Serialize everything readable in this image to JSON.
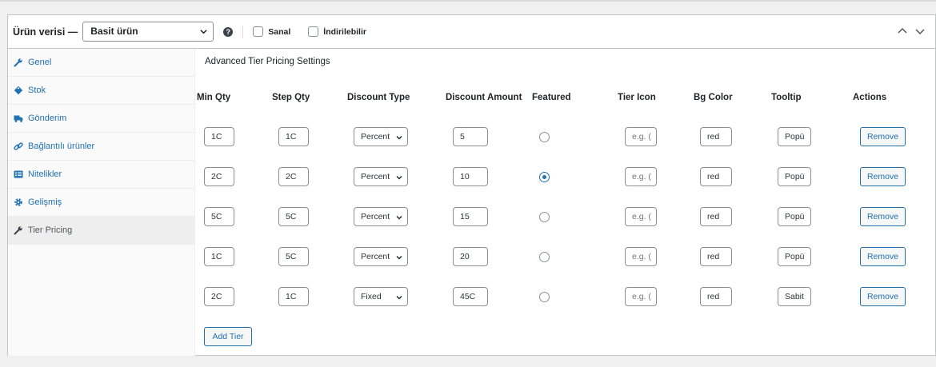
{
  "header": {
    "title": "Ürün verisi —",
    "product_type": "Basit ürün",
    "help_glyph": "?",
    "virtual_label": "Sanal",
    "downloadable_label": "İndirilebilir"
  },
  "sidebar": {
    "items": [
      {
        "label": "Genel",
        "icon": "wrench-icon",
        "active": false
      },
      {
        "label": "Stok",
        "icon": "tag-icon",
        "active": false
      },
      {
        "label": "Gönderim",
        "icon": "truck-icon",
        "active": false
      },
      {
        "label": "Bağlantılı ürünler",
        "icon": "link-icon",
        "active": false
      },
      {
        "label": "Nitelikler",
        "icon": "list-icon",
        "active": false
      },
      {
        "label": "Gelişmiş",
        "icon": "gear-icon",
        "active": false
      },
      {
        "label": "Tier Pricing",
        "icon": "wrench-icon",
        "active": true
      }
    ]
  },
  "content": {
    "title": "Advanced Tier Pricing Settings",
    "columns": [
      "Min Qty",
      "Step Qty",
      "Discount Type",
      "Discount Amount",
      "Featured",
      "Tier Icon",
      "Bg Color",
      "Tooltip",
      "Actions"
    ],
    "rows": [
      {
        "min_qty": "1C",
        "step_qty": "1C",
        "discount_type": "Percent",
        "amount": "5",
        "featured": false,
        "icon_placeholder": "e.g. (",
        "bg_color": "red",
        "tooltip": "Popü",
        "action": "Remove"
      },
      {
        "min_qty": "2C",
        "step_qty": "2C",
        "discount_type": "Percent",
        "amount": "10",
        "featured": true,
        "icon_placeholder": "e.g. (",
        "bg_color": "red",
        "tooltip": "Popü",
        "action": "Remove"
      },
      {
        "min_qty": "5C",
        "step_qty": "5C",
        "discount_type": "Percent",
        "amount": "15",
        "featured": false,
        "icon_placeholder": "e.g. (",
        "bg_color": "red",
        "tooltip": "Popü",
        "action": "Remove"
      },
      {
        "min_qty": "1C",
        "step_qty": "5C",
        "discount_type": "Percent",
        "amount": "20",
        "featured": false,
        "icon_placeholder": "e.g. (",
        "bg_color": "red",
        "tooltip": "Popü",
        "action": "Remove"
      },
      {
        "min_qty": "2C",
        "step_qty": "1C",
        "discount_type": "Fixed",
        "amount": "45C",
        "featured": false,
        "icon_placeholder": "e.g. (",
        "bg_color": "red",
        "tooltip": "Sabit",
        "action": "Remove"
      }
    ],
    "add_label": "Add Tier"
  },
  "colors": {
    "accent": "#2271b1",
    "border": "#8c8f94",
    "text": "#1d2327"
  }
}
